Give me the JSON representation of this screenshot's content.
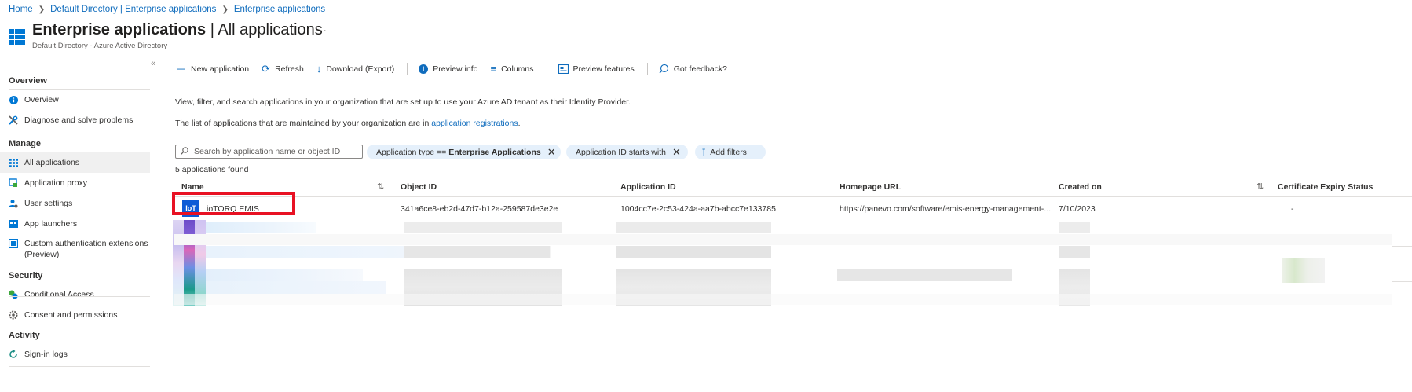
{
  "breadcrumb": [
    "Home",
    "Default Directory | Enterprise applications",
    "Enterprise applications"
  ],
  "header": {
    "title_prefix": "Enterprise applications",
    "title_suffix": " | All applications",
    "more": "···",
    "subtitle": "Default Directory - Azure Active Directory",
    "collapse": "«"
  },
  "sidebar": {
    "overview_section": "Overview",
    "overview": "Overview",
    "diagnose": "Diagnose and solve problems",
    "manage_section": "Manage",
    "all_apps": "All applications",
    "app_proxy": "Application proxy",
    "user_settings": "User settings",
    "app_launchers": "App launchers",
    "custom_auth_1": "Custom authentication extensions",
    "custom_auth_2": "(Preview)",
    "security_section": "Security",
    "conditional_access": "Conditional Access",
    "consent": "Consent and permissions",
    "activity_section": "Activity",
    "signin_logs": "Sign-in logs"
  },
  "toolbar": {
    "new_app": "New application",
    "refresh": "Refresh",
    "download": "Download (Export)",
    "preview_info": "Preview info",
    "columns": "Columns",
    "preview_features": "Preview features",
    "feedback": "Got feedback?"
  },
  "content": {
    "desc1": "View, filter, and search applications in your organization that are set up to use your Azure AD tenant as their Identity Provider.",
    "desc2_prefix": "The list of applications that are maintained by your organization are in ",
    "desc2_link": "application registrations",
    "desc2_suffix": ".",
    "search_placeholder": "Search by application name or object ID",
    "filter1_prefix": "Application type == ",
    "filter1_value": "Enterprise Applications",
    "filter2": "Application ID starts with",
    "add_filters": "Add filters",
    "count": "5 applications found"
  },
  "table": {
    "headers": {
      "name": "Name",
      "object_id": "Object ID",
      "app_id": "Application ID",
      "homepage": "Homepage URL",
      "created": "Created on",
      "cert": "Certificate Expiry Status"
    },
    "row": {
      "logo": "IoT",
      "name": "ioTORQ EMIS",
      "object_id": "341a6ce8-eb2d-47d7-b12a-259587de3e2e",
      "app_id": "1004cc7e-2c53-424a-aa7b-abcc7e133785",
      "homepage": "https://panevo.com/software/emis-energy-management-...",
      "created": "7/10/2023",
      "cert": "-"
    }
  },
  "colors": {
    "accent": "#0f6cbd",
    "highlight": "#e81123",
    "pill": "#e5f0fb"
  }
}
